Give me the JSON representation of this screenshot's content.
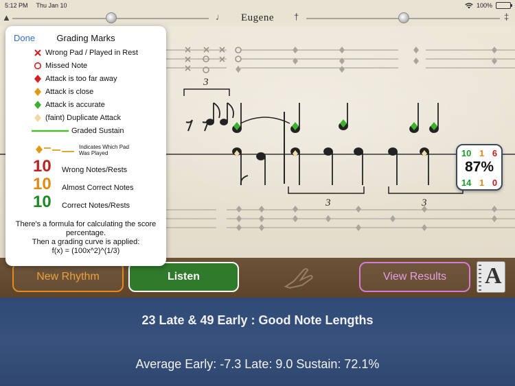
{
  "status_bar": {
    "time": "5:12 PM",
    "date": "Thu Jan 10",
    "battery": "100%",
    "battery_level": 1.0
  },
  "header": {
    "title": "Eugene",
    "left_icon": "metronome-icon",
    "right_icon": "runner-icon"
  },
  "grading_panel": {
    "done_label": "Done",
    "title": "Grading Marks",
    "items": [
      {
        "icon": "x-mark-icon",
        "label": "Wrong Pad / Played in Rest",
        "color": "#d42020"
      },
      {
        "icon": "circle-mark-icon",
        "label": "Missed Note",
        "color": "#d42020"
      },
      {
        "icon": "diamond-red-icon",
        "label": "Attack is too far away",
        "color": "#d42020"
      },
      {
        "icon": "diamond-orange-icon",
        "label": "Attack is close",
        "color": "#e09a10"
      },
      {
        "icon": "diamond-green-icon",
        "label": "Attack is accurate",
        "color": "#3db030"
      },
      {
        "icon": "diamond-faint-icon",
        "label": "(faint) Duplicate Attack",
        "color": "#f0d8a8"
      },
      {
        "icon": "sustain-line-icon",
        "label": "Graded Sustain",
        "color": "#4cbf2c"
      }
    ],
    "pad_label": "Indicates Which Pad Was Played",
    "scores": [
      {
        "value": "10",
        "label": "Wrong Notes/Rests",
        "color": "#c42020"
      },
      {
        "value": "10",
        "label": "Almost Correct Notes",
        "color": "#e88a12"
      },
      {
        "value": "10",
        "label": "Correct Notes/Rests",
        "color": "#1d8a22"
      }
    ],
    "note_line1": "There's a formula for calculating the score percentage.",
    "note_line2": "Then a grading curve is applied:",
    "note_line3": "f(x) = (100x^2)^(1/3)"
  },
  "score_popup": {
    "correct": "10",
    "almost": "1",
    "wrong": "6",
    "percent": "87%",
    "correct2": "14",
    "almost2": "1",
    "wrong2": "0"
  },
  "score": {
    "tuplet_label": "3"
  },
  "buttons": {
    "new_rhythm": "New Rhythm",
    "listen": "Listen",
    "view_results": "View Results",
    "notebook_letter": "A"
  },
  "results": {
    "summary": "23 Late & 49 Early : Good Note Lengths",
    "averages": "Average Early: -7.3 Late: 9.0 Sustain: 72.1%"
  }
}
